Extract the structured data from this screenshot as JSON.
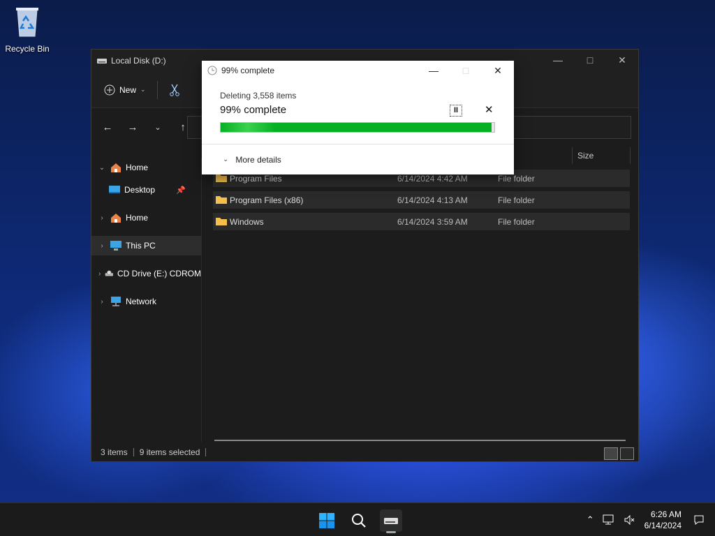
{
  "desktop": {
    "icons": [
      {
        "label": "Recycle Bin",
        "icon": "recycle-bin-icon"
      }
    ]
  },
  "explorer": {
    "title": "Local Disk (D:)",
    "cmdbar": {
      "new_label": "New"
    },
    "sidebar": {
      "items": [
        {
          "label": "Home",
          "icon": "home-icon",
          "expanded": true
        },
        {
          "label": "Desktop",
          "icon": "desktop-icon",
          "pinned": true
        },
        {
          "label": "Home",
          "icon": "home-icon"
        },
        {
          "label": "This PC",
          "icon": "pc-icon",
          "selected": true
        },
        {
          "label": "CD Drive (E:) CDROM",
          "icon": "cd-drive-icon"
        },
        {
          "label": "Network",
          "icon": "network-icon"
        }
      ]
    },
    "columns": {
      "size": "Size"
    },
    "files": [
      {
        "name": "Program Files",
        "date": "6/14/2024 4:42 AM",
        "type": "File folder"
      },
      {
        "name": "Program Files (x86)",
        "date": "6/14/2024 4:13 AM",
        "type": "File folder"
      },
      {
        "name": "Windows",
        "date": "6/14/2024 3:59 AM",
        "type": "File folder"
      }
    ],
    "status": {
      "items": "3 items",
      "selected": "9 items selected"
    }
  },
  "dialog": {
    "title": "99% complete",
    "subtitle": "Deleting 3,558 items",
    "progress_text": "99% complete",
    "progress": 0.99,
    "pause_label": "II",
    "more_details": "More details",
    "accent": "#06b025"
  },
  "taskbar": {
    "time": "6:26 AM",
    "date": "6/14/2024"
  }
}
